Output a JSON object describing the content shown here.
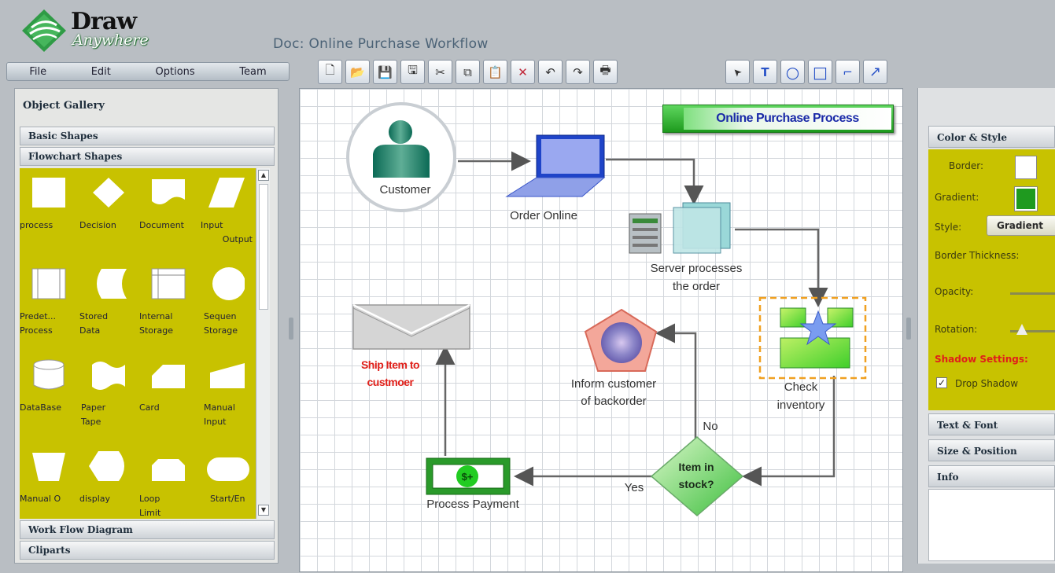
{
  "app": {
    "logo_main": "Draw",
    "logo_sub": "Anywhere",
    "doc_title": "Doc: Online Purchase Workflow"
  },
  "menu": [
    "File",
    "Edit",
    "Options",
    "Team"
  ],
  "toolbar": {
    "file_tools": [
      "new-doc-icon",
      "open-folder-icon",
      "save-icon",
      "save-as-icon",
      "cut-icon",
      "copy-icon",
      "paste-icon",
      "delete-icon",
      "undo-icon",
      "redo-icon",
      "print-icon"
    ],
    "draw_tools": [
      "pointer-icon",
      "text-tool-icon",
      "ellipse-tool-icon",
      "rectangle-tool-icon",
      "connector-tool-icon",
      "arrow-tool-icon"
    ],
    "glyphs": {
      "file": [
        "🗋",
        "📂",
        "💾",
        "🖫",
        "✂",
        "⧉",
        "📋",
        "✕",
        "↶",
        "↷",
        "🖶"
      ],
      "draw": [
        "➤",
        "T",
        "○",
        "□",
        "⌐",
        "↗"
      ]
    }
  },
  "gallery": {
    "title": "Object Gallery",
    "sections_top": [
      "Basic Shapes",
      "Flowchart Shapes"
    ],
    "sections_bottom": [
      "Work Flow Diagram",
      "Cliparts"
    ],
    "shapes": [
      [
        "process"
      ],
      [
        "Decision"
      ],
      [
        "Document"
      ],
      [
        "Input",
        "Output"
      ],
      [
        "Predet...",
        "Process"
      ],
      [
        "Stored",
        "Data"
      ],
      [
        "Internal",
        "Storage"
      ],
      [
        "Sequen",
        "Storage"
      ],
      [
        "DataBase"
      ],
      [
        "Paper",
        "Tape"
      ],
      [
        "Card"
      ],
      [
        "Manual",
        "Input"
      ],
      [
        "Manual O"
      ],
      [
        "display"
      ],
      [
        "Loop",
        "Limit"
      ],
      [
        "Start/En"
      ]
    ]
  },
  "diagram": {
    "title": "Online Purchase Process",
    "nodes": {
      "customer": "Customer",
      "order_online": "Order Online",
      "server_line1": "Server processes",
      "server_line2": "the order",
      "check_line1": "Check",
      "check_line2": "inventory",
      "decision_line1": "Item in",
      "decision_line2": "stock?",
      "inform_line1": "Inform customer",
      "inform_line2": "of backorder",
      "payment": "Process Payment",
      "ship_line1": "Ship Item to",
      "ship_line2": "custmoer"
    },
    "edge_labels": {
      "no": "No",
      "yes": "Yes"
    }
  },
  "properties": {
    "color_style": "Color & Style",
    "border_label": "Border:",
    "gradient_label": "Gradient:",
    "style_label": "Style:",
    "style_value": "Gradient",
    "border_thickness_label": "Border Thickness:",
    "opacity_label": "Opacity:",
    "rotation_label": "Rotation:",
    "shadow_settings": "Shadow Settings:",
    "drop_shadow": "Drop Shadow",
    "drop_shadow_checked": true,
    "text_font": "Text & Font",
    "size_position": "Size & Position",
    "info": "Info",
    "colors": {
      "border_swatch": "#ffffff",
      "gradient_swatch": "#1f9a1f",
      "panel_accent": "#c8c200",
      "shadow_text": "#e0201a"
    }
  }
}
